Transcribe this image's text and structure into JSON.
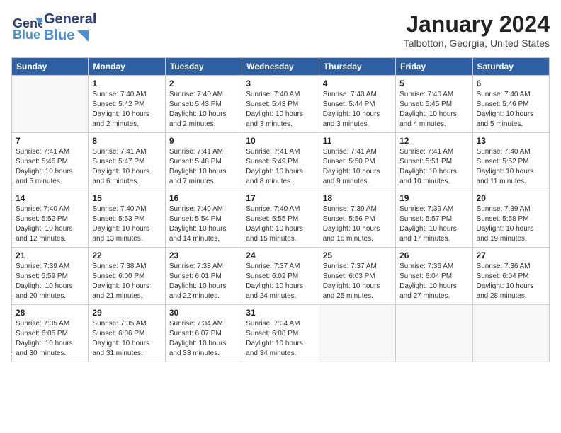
{
  "header": {
    "logo_line1": "General",
    "logo_line2": "Blue",
    "title": "January 2024",
    "location": "Talbotton, Georgia, United States"
  },
  "days_of_week": [
    "Sunday",
    "Monday",
    "Tuesday",
    "Wednesday",
    "Thursday",
    "Friday",
    "Saturday"
  ],
  "weeks": [
    [
      {
        "day": "",
        "info": ""
      },
      {
        "day": "1",
        "info": "Sunrise: 7:40 AM\nSunset: 5:42 PM\nDaylight: 10 hours\nand 2 minutes."
      },
      {
        "day": "2",
        "info": "Sunrise: 7:40 AM\nSunset: 5:43 PM\nDaylight: 10 hours\nand 2 minutes."
      },
      {
        "day": "3",
        "info": "Sunrise: 7:40 AM\nSunset: 5:43 PM\nDaylight: 10 hours\nand 3 minutes."
      },
      {
        "day": "4",
        "info": "Sunrise: 7:40 AM\nSunset: 5:44 PM\nDaylight: 10 hours\nand 3 minutes."
      },
      {
        "day": "5",
        "info": "Sunrise: 7:40 AM\nSunset: 5:45 PM\nDaylight: 10 hours\nand 4 minutes."
      },
      {
        "day": "6",
        "info": "Sunrise: 7:40 AM\nSunset: 5:46 PM\nDaylight: 10 hours\nand 5 minutes."
      }
    ],
    [
      {
        "day": "7",
        "info": "Sunrise: 7:41 AM\nSunset: 5:46 PM\nDaylight: 10 hours\nand 5 minutes."
      },
      {
        "day": "8",
        "info": "Sunrise: 7:41 AM\nSunset: 5:47 PM\nDaylight: 10 hours\nand 6 minutes."
      },
      {
        "day": "9",
        "info": "Sunrise: 7:41 AM\nSunset: 5:48 PM\nDaylight: 10 hours\nand 7 minutes."
      },
      {
        "day": "10",
        "info": "Sunrise: 7:41 AM\nSunset: 5:49 PM\nDaylight: 10 hours\nand 8 minutes."
      },
      {
        "day": "11",
        "info": "Sunrise: 7:41 AM\nSunset: 5:50 PM\nDaylight: 10 hours\nand 9 minutes."
      },
      {
        "day": "12",
        "info": "Sunrise: 7:41 AM\nSunset: 5:51 PM\nDaylight: 10 hours\nand 10 minutes."
      },
      {
        "day": "13",
        "info": "Sunrise: 7:40 AM\nSunset: 5:52 PM\nDaylight: 10 hours\nand 11 minutes."
      }
    ],
    [
      {
        "day": "14",
        "info": "Sunrise: 7:40 AM\nSunset: 5:52 PM\nDaylight: 10 hours\nand 12 minutes."
      },
      {
        "day": "15",
        "info": "Sunrise: 7:40 AM\nSunset: 5:53 PM\nDaylight: 10 hours\nand 13 minutes."
      },
      {
        "day": "16",
        "info": "Sunrise: 7:40 AM\nSunset: 5:54 PM\nDaylight: 10 hours\nand 14 minutes."
      },
      {
        "day": "17",
        "info": "Sunrise: 7:40 AM\nSunset: 5:55 PM\nDaylight: 10 hours\nand 15 minutes."
      },
      {
        "day": "18",
        "info": "Sunrise: 7:39 AM\nSunset: 5:56 PM\nDaylight: 10 hours\nand 16 minutes."
      },
      {
        "day": "19",
        "info": "Sunrise: 7:39 AM\nSunset: 5:57 PM\nDaylight: 10 hours\nand 17 minutes."
      },
      {
        "day": "20",
        "info": "Sunrise: 7:39 AM\nSunset: 5:58 PM\nDaylight: 10 hours\nand 19 minutes."
      }
    ],
    [
      {
        "day": "21",
        "info": "Sunrise: 7:39 AM\nSunset: 5:59 PM\nDaylight: 10 hours\nand 20 minutes."
      },
      {
        "day": "22",
        "info": "Sunrise: 7:38 AM\nSunset: 6:00 PM\nDaylight: 10 hours\nand 21 minutes."
      },
      {
        "day": "23",
        "info": "Sunrise: 7:38 AM\nSunset: 6:01 PM\nDaylight: 10 hours\nand 22 minutes."
      },
      {
        "day": "24",
        "info": "Sunrise: 7:37 AM\nSunset: 6:02 PM\nDaylight: 10 hours\nand 24 minutes."
      },
      {
        "day": "25",
        "info": "Sunrise: 7:37 AM\nSunset: 6:03 PM\nDaylight: 10 hours\nand 25 minutes."
      },
      {
        "day": "26",
        "info": "Sunrise: 7:36 AM\nSunset: 6:04 PM\nDaylight: 10 hours\nand 27 minutes."
      },
      {
        "day": "27",
        "info": "Sunrise: 7:36 AM\nSunset: 6:04 PM\nDaylight: 10 hours\nand 28 minutes."
      }
    ],
    [
      {
        "day": "28",
        "info": "Sunrise: 7:35 AM\nSunset: 6:05 PM\nDaylight: 10 hours\nand 30 minutes."
      },
      {
        "day": "29",
        "info": "Sunrise: 7:35 AM\nSunset: 6:06 PM\nDaylight: 10 hours\nand 31 minutes."
      },
      {
        "day": "30",
        "info": "Sunrise: 7:34 AM\nSunset: 6:07 PM\nDaylight: 10 hours\nand 33 minutes."
      },
      {
        "day": "31",
        "info": "Sunrise: 7:34 AM\nSunset: 6:08 PM\nDaylight: 10 hours\nand 34 minutes."
      },
      {
        "day": "",
        "info": ""
      },
      {
        "day": "",
        "info": ""
      },
      {
        "day": "",
        "info": ""
      }
    ]
  ]
}
